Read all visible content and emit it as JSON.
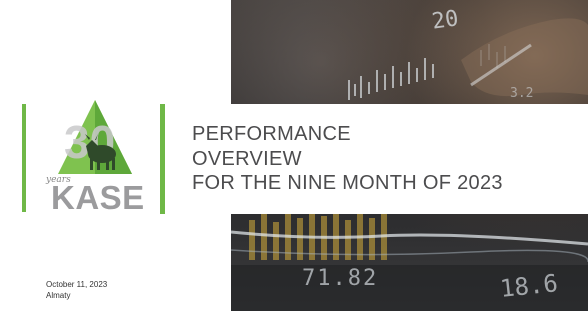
{
  "title": {
    "line1": "PERFORMANCE",
    "line2": "OVERVIEW",
    "line3": "FOR THE NINE MONTH OF 2023"
  },
  "logo": {
    "number": "30",
    "script": "years",
    "word": "KASE"
  },
  "footer": {
    "date": "October 11, 2023",
    "city": "Almaty"
  },
  "background_figures": [
    "20",
    "71.82",
    "18.6",
    "3.2"
  ],
  "colors": {
    "accent_green": "#6fb847",
    "title_text": "#4c4c4e",
    "logo_grey": "#9b9b9d"
  }
}
